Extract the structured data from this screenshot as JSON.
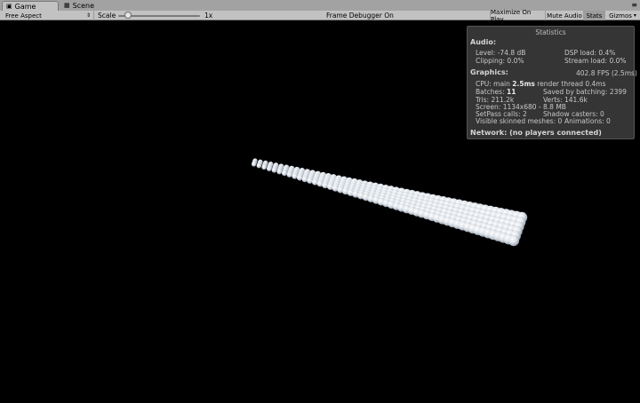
{
  "tabs": {
    "game": "Game",
    "scene": "Scene"
  },
  "toolbar": {
    "aspect": "Free Aspect",
    "scale_label": "Scale",
    "scale_value": "1x",
    "scale_fraction": 0.12,
    "frame_debugger": "Frame Debugger On",
    "maximize": "Maximize On Play",
    "mute": "Mute Audio",
    "stats": "Stats",
    "gizmos": "Gizmos"
  },
  "statistics": {
    "title": "Statistics",
    "audio_heading": "Audio:",
    "level": "Level: -74.8 dB",
    "dsp": "DSP load: 0.4%",
    "clipping": "Clipping: 0.0%",
    "stream": "Stream load: 0.0%",
    "graphics_heading": "Graphics:",
    "fps": "402.8 FPS (2.5ms)",
    "cpu_prefix": "CPU: main",
    "cpu_main": "2.5ms",
    "cpu_render": "render thread 0.4ms",
    "batches_prefix": "Batches:",
    "batches": "11",
    "saved": "Saved by batching: 2399",
    "tris": "Tris: 211.2k",
    "verts": "Verts: 141.6k",
    "screen": "Screen: 1134x680 - 8.8 MB",
    "setpass": "SetPass calls: 2",
    "shadow": "Shadow casters: 0",
    "skinned": "Visible skinned meshes: 0",
    "animations": "Animations: 0",
    "network": "Network: (no players connected)"
  },
  "colors": {
    "sphere": "#dfe4ea",
    "sphere_shadow": "#8f99a6"
  }
}
